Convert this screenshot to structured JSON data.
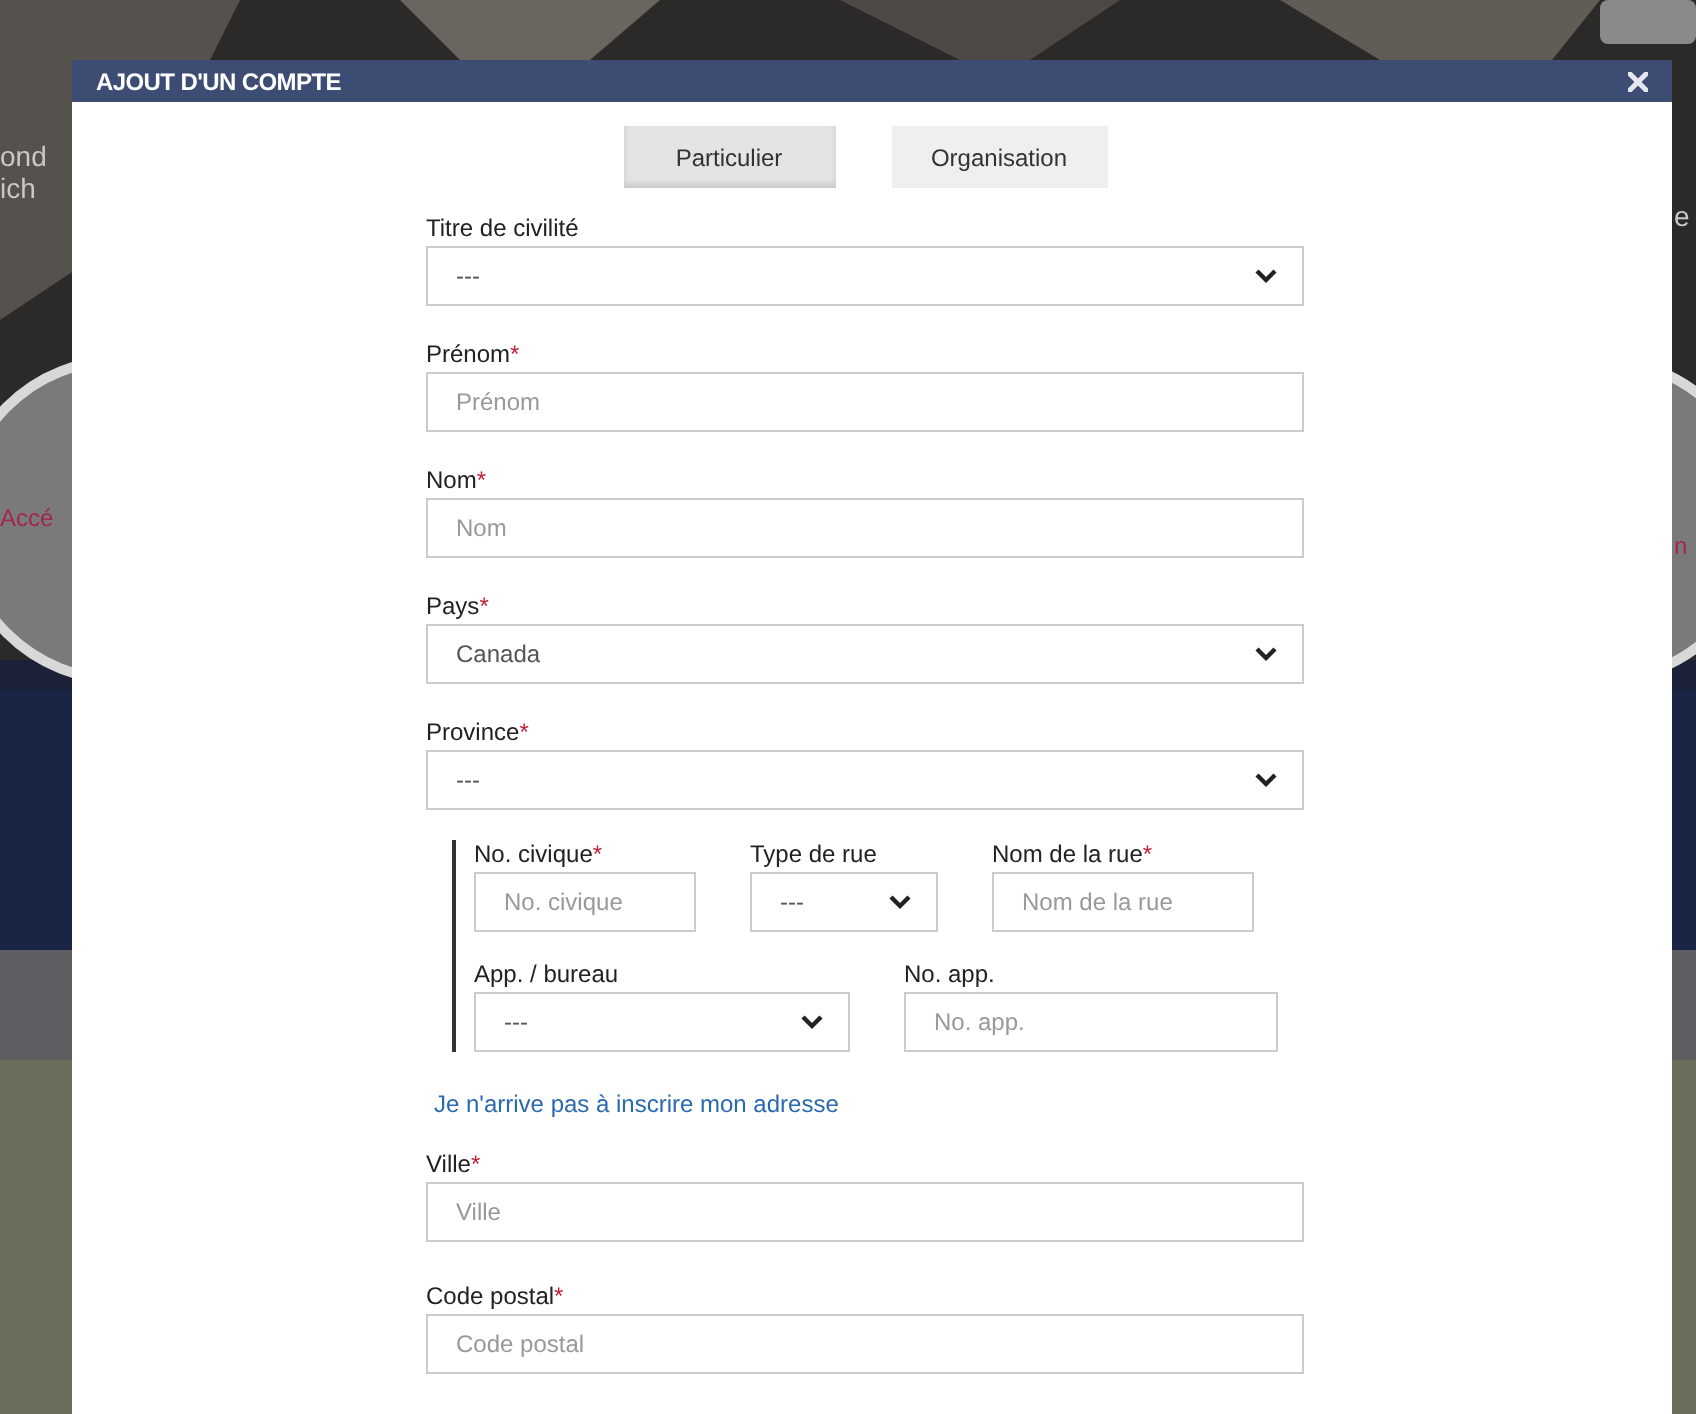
{
  "background": {
    "left_texts": [
      {
        "text": "ond",
        "kind": "plain"
      },
      {
        "text": "ich",
        "kind": "plain"
      },
      {
        "text": "Accé",
        "kind": "accent"
      }
    ],
    "right_texts": [
      {
        "text": "e",
        "kind": "plain"
      },
      {
        "text": "n",
        "kind": "accent"
      }
    ]
  },
  "dialog": {
    "title": "AJOUT D'UN COMPTE"
  },
  "tabs": [
    {
      "label": "Particulier",
      "selected": true
    },
    {
      "label": "Organisation",
      "selected": false
    }
  ],
  "fields": [
    {
      "kind": "select",
      "label": "Titre de civilité",
      "value": "---"
    },
    {
      "kind": "input",
      "label": "Prénom",
      "mark": "*",
      "placeholder": "Prénom"
    },
    {
      "kind": "input",
      "label": "Nom",
      "mark": "*",
      "placeholder": "Nom"
    },
    {
      "kind": "select",
      "label": "Pays",
      "mark": "*",
      "value": "Canada"
    },
    {
      "kind": "select",
      "label": "Province",
      "mark": "*",
      "value": "---"
    }
  ],
  "address_rows": [
    [
      {
        "kind": "input",
        "label": "No. civique",
        "mark": "*",
        "placeholder": "No. civique"
      },
      {
        "kind": "select",
        "label": "Type de rue",
        "value": "---"
      },
      {
        "kind": "input",
        "label": "Nom de la rue",
        "mark": "*",
        "placeholder": "Nom de la rue"
      }
    ],
    [
      {
        "kind": "select",
        "label": "App. / bureau",
        "value": "---"
      },
      {
        "kind": "input",
        "label": "No. app.",
        "placeholder": "No. app."
      }
    ]
  ],
  "address_link": "Je n'arrive pas à inscrire mon adresse",
  "fields_after": [
    {
      "kind": "input",
      "label": "Ville",
      "mark": "*",
      "placeholder": "Ville"
    },
    {
      "kind": "input",
      "label": "Code postal",
      "mark": "*",
      "placeholder": "Code postal"
    }
  ]
}
